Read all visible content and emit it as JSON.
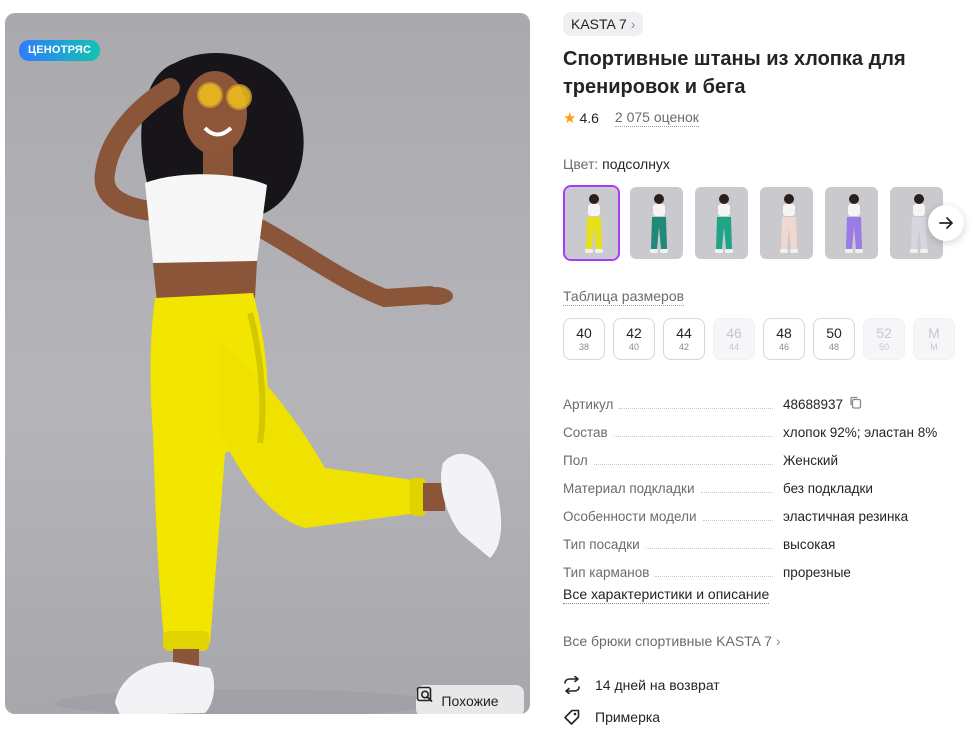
{
  "product": {
    "promo_badge": "ЦЕНОТРЯС",
    "similar_label": "Похожие",
    "brand": "KASTA 7",
    "title": "Спортивные штаны из хлопка для тренировок и бега",
    "rating": "4.6",
    "reviews": "2 075 оценок",
    "color_label": "Цвет:",
    "color_value": "подсолнух",
    "color_thumbs": [
      {
        "pants": "#e8e01a"
      },
      {
        "pants": "#1f8a78"
      },
      {
        "pants": "#1fa585"
      },
      {
        "pants": "#f0d8cf"
      },
      {
        "pants": "#9b7be6"
      },
      {
        "pants": "#d6d6e0"
      }
    ],
    "size_table_label": "Таблица размеров",
    "sizes": [
      {
        "size": "40",
        "ru": "38",
        "available": true
      },
      {
        "size": "42",
        "ru": "40",
        "available": true
      },
      {
        "size": "44",
        "ru": "42",
        "available": true
      },
      {
        "size": "46",
        "ru": "44",
        "available": false
      },
      {
        "size": "48",
        "ru": "46",
        "available": true
      },
      {
        "size": "50",
        "ru": "48",
        "available": true
      },
      {
        "size": "52",
        "ru": "50",
        "available": false
      },
      {
        "size": "M",
        "ru": "M",
        "available": false
      }
    ],
    "specs": [
      {
        "key": "Артикул",
        "value": "48688937"
      },
      {
        "key": "Состав",
        "value": "хлопок 92%; эластан 8%"
      },
      {
        "key": "Пол",
        "value": "Женский"
      },
      {
        "key": "Материал подкладки",
        "value": "без подкладки"
      },
      {
        "key": "Особенности модели",
        "value": "эластичная резинка"
      },
      {
        "key": "Тип посадки",
        "value": "высокая"
      },
      {
        "key": "Тип карманов",
        "value": "прорезные"
      }
    ],
    "all_specs_link": "Все характеристики и описание",
    "all_brand_link": "Все брюки спортивные KASTA 7",
    "features": [
      {
        "icon": "return-arrows-icon",
        "label": "14 дней на возврат"
      },
      {
        "icon": "tag-icon",
        "label": "Примерка"
      }
    ]
  },
  "colors": {
    "accent": "#a73afd",
    "star": "#ff9f0a",
    "pants_main": "#f2e600",
    "badge_gradient": [
      "#2f7bff",
      "#14c4b0"
    ]
  }
}
